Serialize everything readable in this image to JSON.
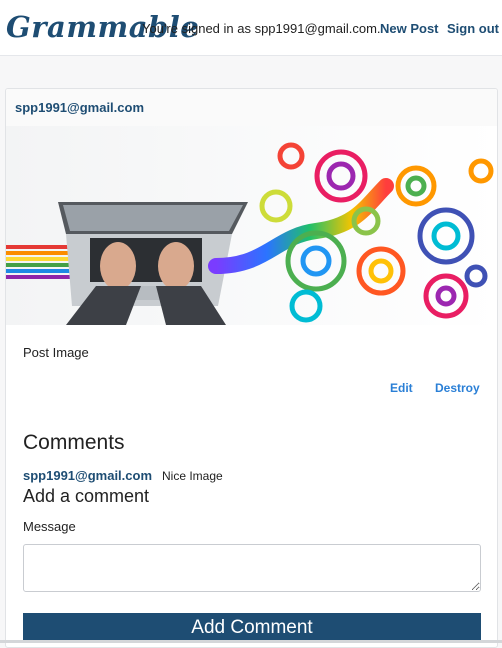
{
  "navbar": {
    "brand": "Grammable",
    "signed_in_text": "You're signed in as spp1991@gmail.com.",
    "new_post_label": "New Post",
    "sign_out_label": "Sign out"
  },
  "post": {
    "author": "spp1991@gmail.com",
    "image_description": "laptop with colorful rainbow swirls",
    "caption": "Post Image",
    "edit_label": "Edit",
    "destroy_label": "Destroy"
  },
  "comments": {
    "heading": "Comments",
    "items": [
      {
        "author": "spp1991@gmail.com",
        "text": "Nice Image"
      }
    ]
  },
  "add_comment": {
    "heading": "Add a comment",
    "message_label": "Message",
    "message_value": "",
    "submit_label": "Add Comment"
  },
  "colors": {
    "brand": "#1e4d73",
    "link": "#2a7fd6",
    "button_bg": "#1e4d73"
  }
}
